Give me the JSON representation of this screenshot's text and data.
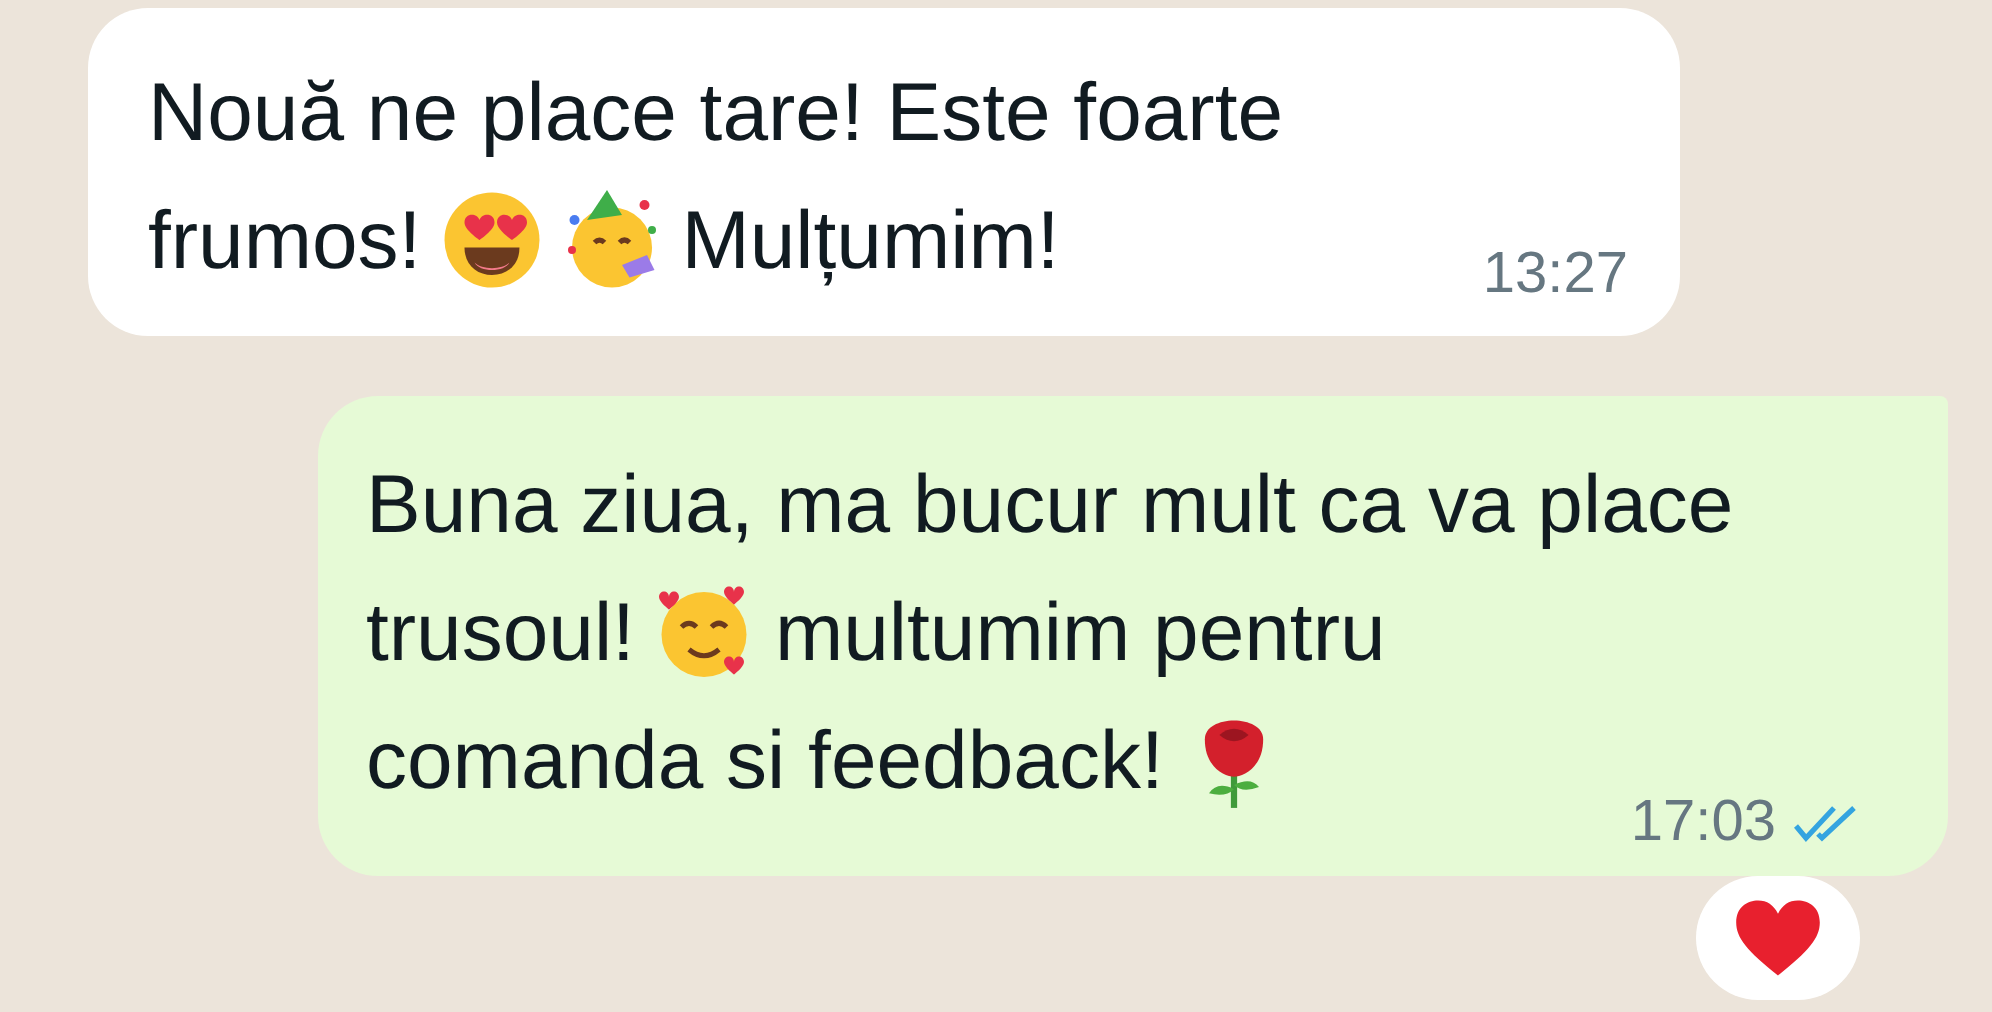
{
  "messages": [
    {
      "outgoing": false,
      "lines": [
        [
          {
            "kind": "text",
            "text": "Nouă ne place tare! Este foarte"
          }
        ],
        [
          {
            "kind": "text",
            "text": "frumos!"
          },
          {
            "kind": "heart_eyes"
          },
          {
            "kind": "party"
          },
          {
            "kind": "text",
            "text": "Mulțumim!"
          }
        ]
      ],
      "time": "13:27"
    },
    {
      "outgoing": true,
      "lines": [
        [
          {
            "kind": "text",
            "text": "Buna ziua, ma bucur mult ca va place"
          }
        ],
        [
          {
            "kind": "text",
            "text": "trusoul!"
          },
          {
            "kind": "smiling_hearts"
          },
          {
            "kind": "text",
            "text": "multumim pentru"
          }
        ],
        [
          {
            "kind": "text",
            "text": "comanda si feedback!"
          },
          {
            "kind": "rose"
          }
        ]
      ],
      "time": "17:03",
      "read": true,
      "reaction": {
        "kind": "heart"
      }
    }
  ]
}
